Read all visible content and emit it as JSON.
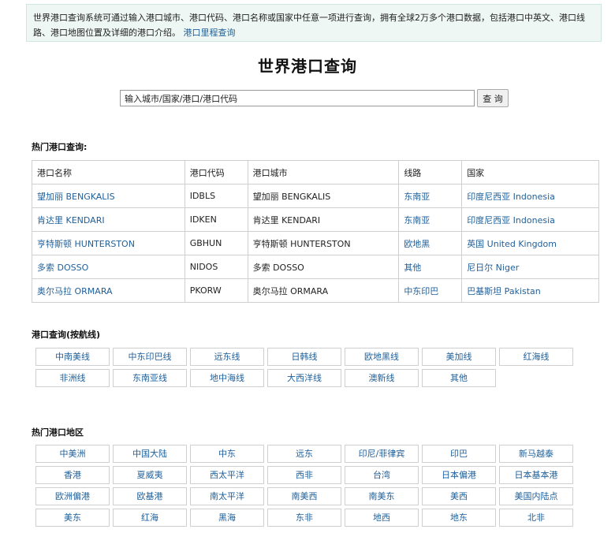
{
  "notice": {
    "text": "世界港口查询系统可通过输入港口城市、港口代码、港口名称或国家中任意一项进行查询，拥有全球2万多个港口数据，包括港口中英文、港口线路、港口地图位置及详细的港口介绍。",
    "link": "港口里程查询"
  },
  "title": "世界港口查询",
  "search": {
    "value": "输入城市/国家/港口/港口代码",
    "button": "查 询"
  },
  "hot_ports": {
    "heading": "热门港口查询:",
    "columns": [
      "港口名称",
      "港口代码",
      "港口城市",
      "线路",
      "国家"
    ],
    "rows": [
      [
        "望加丽 BENGKALIS",
        "IDBLS",
        "望加丽 BENGKALIS",
        "东南亚",
        "印度尼西亚 Indonesia"
      ],
      [
        "肯达里 KENDARI",
        "IDKEN",
        "肯达里 KENDARI",
        "东南亚",
        "印度尼西亚 Indonesia"
      ],
      [
        "亨特斯顿 HUNTERSTON",
        "GBHUN",
        "亨特斯顿 HUNTERSTON",
        "欧地黑",
        "英国 United Kingdom"
      ],
      [
        "多索 DOSSO",
        "NIDOS",
        "多索 DOSSO",
        "其他",
        "尼日尔 Niger"
      ],
      [
        "奥尔马拉 ORMARA",
        "PKORW",
        "奥尔马拉 ORMARA",
        "中东印巴",
        "巴基斯坦 Pakistan"
      ]
    ]
  },
  "routes": {
    "heading": "港口查询(按航线)",
    "items": [
      "中南美线",
      "中东印巴线",
      "远东线",
      "日韩线",
      "欧地黑线",
      "美加线",
      "红海线",
      "非洲线",
      "东南亚线",
      "地中海线",
      "大西洋线",
      "澳新线",
      "其他"
    ]
  },
  "regions": {
    "heading": "热门港口地区",
    "items": [
      "中美洲",
      "中国大陆",
      "中东",
      "远东",
      "印尼/菲律宾",
      "印巴",
      "新马越泰",
      "香港",
      "夏威夷",
      "西太平洋",
      "西非",
      "台湾",
      "日本偏港",
      "日本基本港",
      "欧洲偏港",
      "欧基港",
      "南太平洋",
      "南美西",
      "南美东",
      "美西",
      "美国内陆点",
      "美东",
      "红海",
      "黑海",
      "东非",
      "地西",
      "地东",
      "北非"
    ]
  }
}
